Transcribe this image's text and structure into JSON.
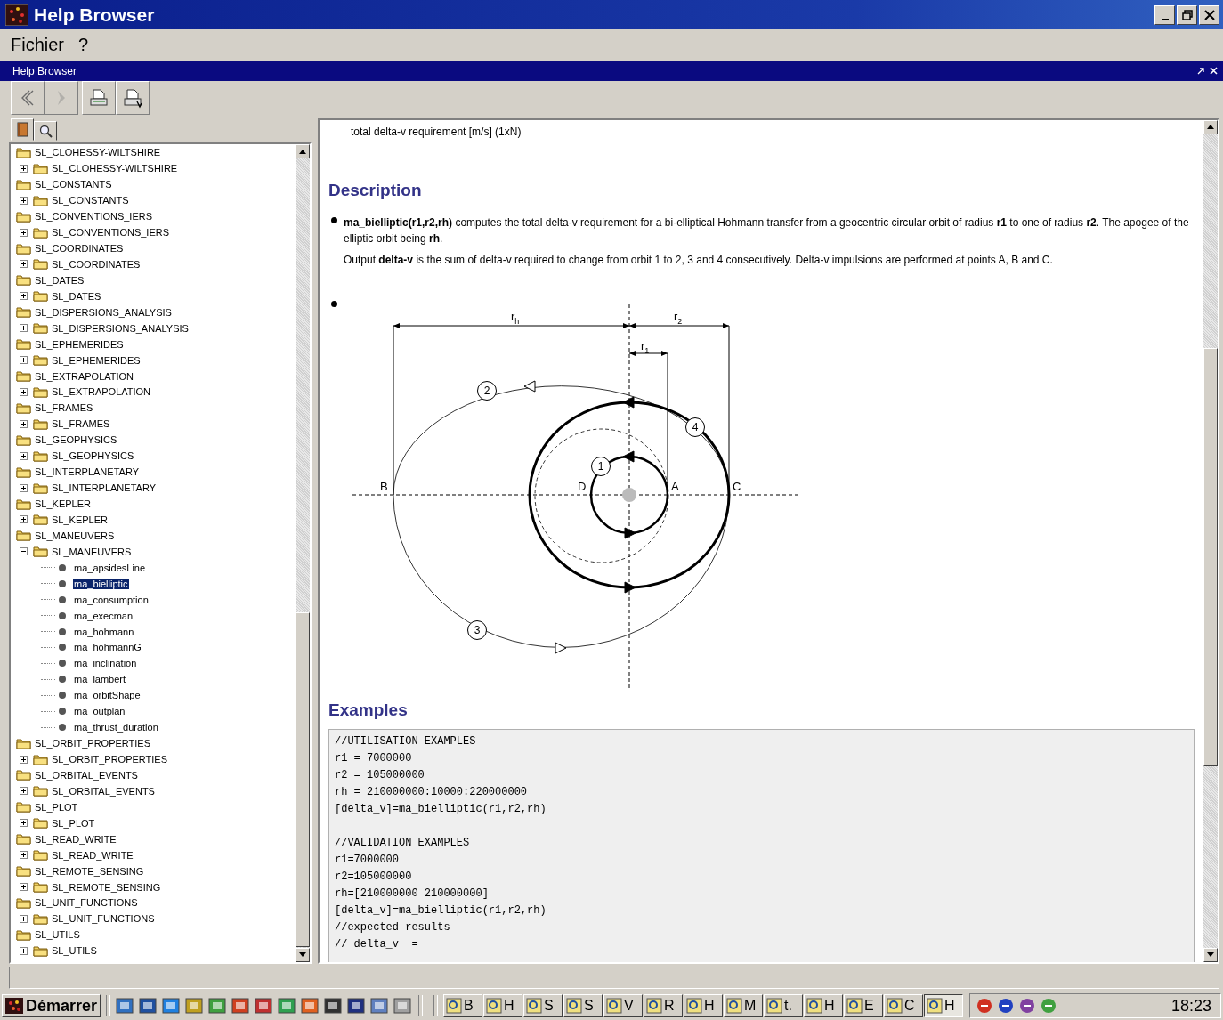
{
  "window": {
    "title": "Help Browser"
  },
  "menu": [
    "Fichier",
    "?"
  ],
  "panel": {
    "title": "Help Browser"
  },
  "toolbar": [
    {
      "kind": "back",
      "disabled": false
    },
    {
      "kind": "forward",
      "disabled": true
    },
    {
      "kind": "print",
      "disabled": false
    },
    {
      "kind": "print-preview",
      "disabled": false
    }
  ],
  "nav_tabs": [
    {
      "kind": "contents",
      "selected": true
    },
    {
      "kind": "search",
      "selected": false
    }
  ],
  "tree": [
    {
      "label": "SL_CLOHESSY-WILTSHIRE",
      "children": [
        {
          "label": "SL_CLOHESSY-WILTSHIRE",
          "expanded": false
        }
      ]
    },
    {
      "label": "SL_CONSTANTS",
      "children": [
        {
          "label": "SL_CONSTANTS",
          "expanded": false
        }
      ]
    },
    {
      "label": "SL_CONVENTIONS_IERS",
      "children": [
        {
          "label": "SL_CONVENTIONS_IERS",
          "expanded": false
        }
      ]
    },
    {
      "label": "SL_COORDINATES",
      "children": [
        {
          "label": "SL_COORDINATES",
          "expanded": false
        }
      ]
    },
    {
      "label": "SL_DATES",
      "children": [
        {
          "label": "SL_DATES",
          "expanded": false
        }
      ]
    },
    {
      "label": "SL_DISPERSIONS_ANALYSIS",
      "children": [
        {
          "label": "SL_DISPERSIONS_ANALYSIS",
          "expanded": false
        }
      ]
    },
    {
      "label": "SL_EPHEMERIDES",
      "children": [
        {
          "label": "SL_EPHEMERIDES",
          "expanded": false
        }
      ]
    },
    {
      "label": "SL_EXTRAPOLATION",
      "children": [
        {
          "label": "SL_EXTRAPOLATION",
          "expanded": false
        }
      ]
    },
    {
      "label": "SL_FRAMES",
      "children": [
        {
          "label": "SL_FRAMES",
          "expanded": false
        }
      ]
    },
    {
      "label": "SL_GEOPHYSICS",
      "children": [
        {
          "label": "SL_GEOPHYSICS",
          "expanded": false
        }
      ]
    },
    {
      "label": "SL_INTERPLANETARY",
      "children": [
        {
          "label": "SL_INTERPLANETARY",
          "expanded": false
        }
      ]
    },
    {
      "label": "SL_KEPLER",
      "children": [
        {
          "label": "SL_KEPLER",
          "expanded": false
        }
      ]
    },
    {
      "label": "SL_MANEUVERS",
      "children": [
        {
          "label": "SL_MANEUVERS",
          "expanded": true,
          "children": [
            {
              "label": "ma_apsidesLine",
              "selected": false
            },
            {
              "label": "ma_bielliptic",
              "selected": true
            },
            {
              "label": "ma_consumption",
              "selected": false
            },
            {
              "label": "ma_execman",
              "selected": false
            },
            {
              "label": "ma_hohmann",
              "selected": false
            },
            {
              "label": "ma_hohmannG",
              "selected": false
            },
            {
              "label": "ma_inclination",
              "selected": false
            },
            {
              "label": "ma_lambert",
              "selected": false
            },
            {
              "label": "ma_orbitShape",
              "selected": false
            },
            {
              "label": "ma_outplan",
              "selected": false
            },
            {
              "label": "ma_thrust_duration",
              "selected": false
            }
          ]
        }
      ]
    },
    {
      "label": "SL_ORBIT_PROPERTIES",
      "children": [
        {
          "label": "SL_ORBIT_PROPERTIES",
          "expanded": false
        }
      ]
    },
    {
      "label": "SL_ORBITAL_EVENTS",
      "children": [
        {
          "label": "SL_ORBITAL_EVENTS",
          "expanded": false
        }
      ]
    },
    {
      "label": "SL_PLOT",
      "children": [
        {
          "label": "SL_PLOT",
          "expanded": false
        }
      ]
    },
    {
      "label": "SL_READ_WRITE",
      "children": [
        {
          "label": "SL_READ_WRITE",
          "expanded": false
        }
      ]
    },
    {
      "label": "SL_REMOTE_SENSING",
      "children": [
        {
          "label": "SL_REMOTE_SENSING",
          "expanded": false
        }
      ]
    },
    {
      "label": "SL_UNIT_FUNCTIONS",
      "children": [
        {
          "label": "SL_UNIT_FUNCTIONS",
          "expanded": false
        }
      ]
    },
    {
      "label": "SL_UTILS",
      "children": [
        {
          "label": "SL_UTILS",
          "expanded": false
        }
      ]
    }
  ],
  "content": {
    "return_text": "total delta-v requirement [m/s] (1xN)",
    "description_heading": "Description",
    "description_paragraphs": [
      "**ma_bielliptic(r1,r2,rh)** computes the total delta-v requirement for a bi-elliptical Hohmann transfer from a geocentric circular orbit of radius **r1** to one of radius **r2**. The apogee of the elliptic orbit being **rh**.",
      "Output **delta-v** is the sum of delta-v required to change from orbit 1 to 2, 3 and 4 consecutively. Delta-v impulsions are performed at points A, B and C."
    ],
    "diagram": {
      "dimension_labels": [
        "r$_{h}$",
        "r$_{2}$",
        "r$_{1}$"
      ],
      "point_labels": [
        "B",
        "D",
        "A",
        "C"
      ],
      "orbit_numbers": [
        "1",
        "2",
        "3",
        "4"
      ]
    },
    "examples_heading": "Examples",
    "examples_code": [
      [
        "//UTILISATION EXAMPLES",
        "r1 = 7000000",
        "r2 = 105000000",
        "rh = 210000000:10000:220000000",
        "[delta_v]=ma_bielliptic(r1,r2,rh)"
      ],
      [
        "//VALIDATION EXAMPLES",
        "r1=7000000",
        "r2=105000000",
        "rh=[210000000 210000000]",
        "[delta_v]=ma_bielliptic(r1,r2,rh)",
        "//expected results",
        "// delta_v  ="
      ]
    ]
  },
  "taskbar": {
    "start": "Démarrer",
    "tasks": [
      {
        "label": "B",
        "selected": false
      },
      {
        "label": "H",
        "selected": false
      },
      {
        "label": "S",
        "selected": false
      },
      {
        "label": "S",
        "selected": false
      },
      {
        "label": "V",
        "selected": false
      },
      {
        "label": "R",
        "selected": false
      },
      {
        "label": "H",
        "selected": false
      },
      {
        "label": "M",
        "selected": false
      },
      {
        "label": "t.",
        "selected": false
      },
      {
        "label": "H",
        "selected": false
      },
      {
        "label": "E",
        "selected": false
      },
      {
        "label": "C",
        "selected": false
      },
      {
        "label": "H",
        "selected": true
      }
    ],
    "clock": "18:23"
  }
}
